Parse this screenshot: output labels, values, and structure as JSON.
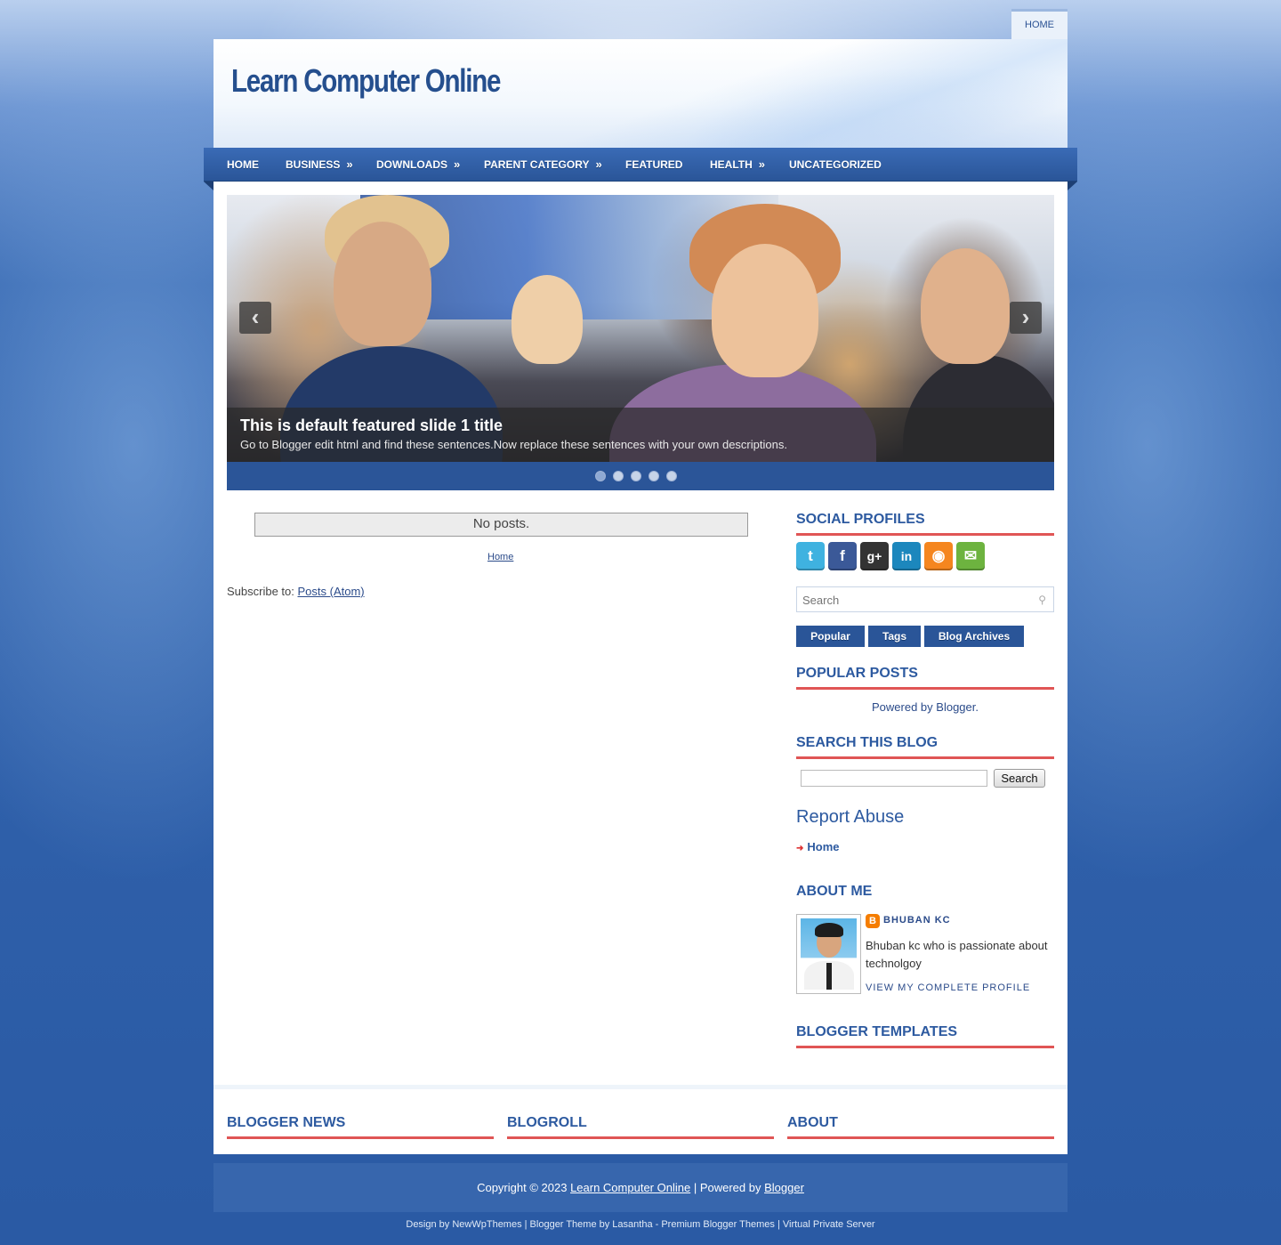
{
  "top_nav": {
    "home": "HOME"
  },
  "site": {
    "title": "Learn Computer Online"
  },
  "main_nav": [
    {
      "label": "HOME",
      "has_sub": false
    },
    {
      "label": "BUSINESS",
      "has_sub": true
    },
    {
      "label": "DOWNLOADS",
      "has_sub": true
    },
    {
      "label": "PARENT CATEGORY",
      "has_sub": true
    },
    {
      "label": "FEATURED",
      "has_sub": false
    },
    {
      "label": "HEALTH",
      "has_sub": true
    },
    {
      "label": "UNCATEGORIZED",
      "has_sub": false
    }
  ],
  "submenu_indicator": "»",
  "slider": {
    "title": "This is default featured slide 1 title",
    "description": "Go to Blogger edit html and find these sentences.Now replace these sentences with your own descriptions.",
    "prev": "‹",
    "next": "›",
    "slide_count": 5,
    "active_slide": 1
  },
  "main": {
    "no_posts": "No posts.",
    "home_link": "Home",
    "subscribe_label": "Subscribe to:",
    "subscribe_link": "Posts (Atom)"
  },
  "sidebar": {
    "social_title": "SOCIAL PROFILES",
    "social_icons": [
      {
        "name": "twitter-icon",
        "glyph": "t",
        "color": "#3fb2e0"
      },
      {
        "name": "facebook-icon",
        "glyph": "f",
        "color": "#3b5998"
      },
      {
        "name": "google-plus-icon",
        "glyph": "g+",
        "color": "#333333"
      },
      {
        "name": "linkedin-icon",
        "glyph": "in",
        "color": "#1c87bd"
      },
      {
        "name": "rss-icon",
        "glyph": "◉",
        "color": "#f5861f"
      },
      {
        "name": "email-icon",
        "glyph": "✉",
        "color": "#6db33f"
      }
    ],
    "search_placeholder": "Search",
    "tabs": [
      "Popular",
      "Tags",
      "Blog Archives"
    ],
    "popular_title": "POPULAR POSTS",
    "powered": "Powered by Blogger.",
    "search_blog_title": "SEARCH THIS BLOG",
    "search_button": "Search",
    "report_abuse": "Report Abuse",
    "abuse_home": "Home",
    "about_title": "ABOUT ME",
    "profile_name": "BHUBAN KC",
    "profile_desc": "Bhuban kc who is passionate about technolgoy",
    "profile_link": "VIEW MY COMPLETE PROFILE",
    "templates_title": "BLOGGER TEMPLATES"
  },
  "footer_widgets": [
    "BLOGGER NEWS",
    "BLOGROLL",
    "ABOUT"
  ],
  "footer": {
    "copyright": "Copyright © 2023",
    "site_link": "Learn Computer Online",
    "powered_by": "| Powered by",
    "blogger_link": "Blogger"
  },
  "credits": "Design by NewWpThemes | Blogger Theme by Lasantha - Premium Blogger Themes | Virtual Private Server",
  "colors": {
    "accent": "#2d5aa0",
    "nav": "#2a5598",
    "underline": "#e05555"
  }
}
